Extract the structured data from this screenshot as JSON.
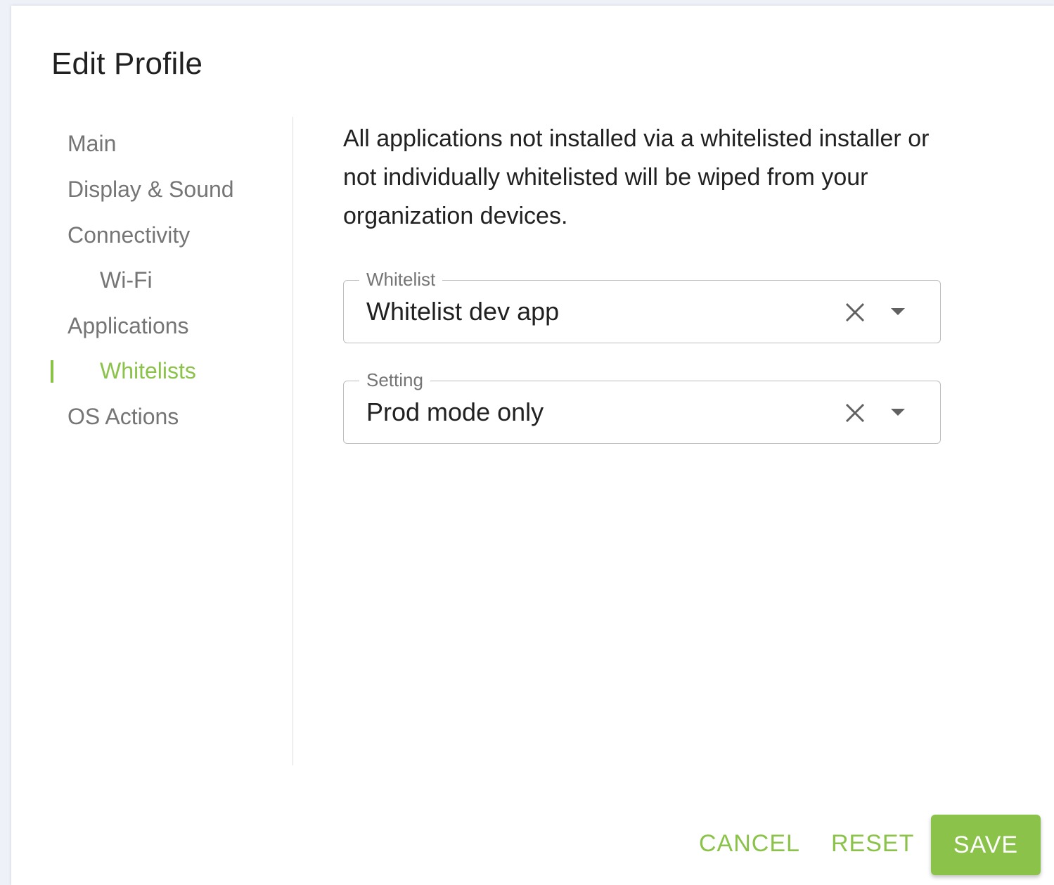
{
  "dialog": {
    "title": "Edit Profile"
  },
  "sidebar": {
    "items": [
      {
        "label": "Main"
      },
      {
        "label": "Display & Sound"
      },
      {
        "label": "Connectivity"
      },
      {
        "label": "Wi-Fi"
      },
      {
        "label": "Applications"
      },
      {
        "label": "Whitelists"
      },
      {
        "label": "OS Actions"
      }
    ],
    "active_item": "Whitelists"
  },
  "content": {
    "description": "All applications not installed via a whitelisted installer or not individually whitelisted will be wiped from your organization devices.",
    "fields": [
      {
        "label": "Whitelist",
        "value": "Whitelist dev app"
      },
      {
        "label": "Setting",
        "value": "Prod mode only"
      }
    ]
  },
  "actions": {
    "cancel_label": "CANCEL",
    "reset_label": "RESET",
    "save_label": "SAVE"
  },
  "colors": {
    "accent": "#8bc34a",
    "text_primary": "#212121",
    "text_secondary": "#757575"
  },
  "icons": {
    "clear": "close-icon",
    "dropdown": "chevron-down-icon"
  }
}
